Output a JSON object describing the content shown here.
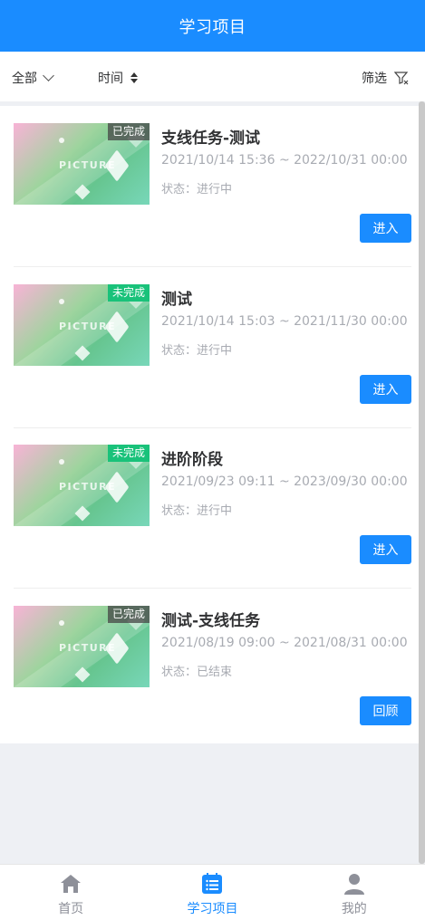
{
  "header": {
    "title": "学习项目"
  },
  "filters": {
    "all_label": "全部",
    "time_label": "时间",
    "screen_label": "筛选"
  },
  "thumb_text": "PICTURE",
  "projects": [
    {
      "title": "支线任务-测试",
      "badge": "已完成",
      "badge_type": "done",
      "date": "2021/10/14 15:36 ~ 2022/10/31 00:00",
      "status": "状态：进行中",
      "button": "进入"
    },
    {
      "title": "测试",
      "badge": "未完成",
      "badge_type": "undone",
      "date": "2021/10/14 15:03 ~ 2021/11/30 00:00",
      "status": "状态：进行中",
      "button": "进入"
    },
    {
      "title": "进阶阶段",
      "badge": "未完成",
      "badge_type": "undone",
      "date": "2021/09/23 09:11 ~ 2023/09/30 00:00",
      "status": "状态：进行中",
      "button": "进入"
    },
    {
      "title": "测试-支线任务",
      "badge": "已完成",
      "badge_type": "done",
      "date": "2021/08/19 09:00 ~ 2021/08/31 00:00",
      "status": "状态：已结束",
      "button": "回顾"
    }
  ],
  "tabbar": {
    "home": "首页",
    "projects": "学习项目",
    "mine": "我的"
  },
  "colors": {
    "primary": "#1a8cff",
    "done_badge": "#555555",
    "undone_badge": "#19c27a"
  },
  "icons": [
    "chevron-down-icon",
    "sort-icon",
    "filter-icon",
    "home-icon",
    "list-icon",
    "user-icon"
  ]
}
